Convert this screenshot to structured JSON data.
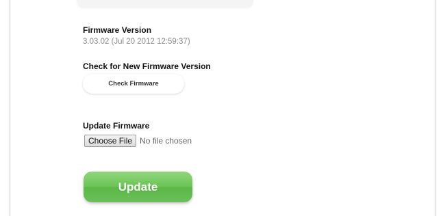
{
  "firmware": {
    "version_title": "Firmware Version",
    "version_value": "3.03.02 (Jul 20 2012 12:59:37)",
    "check_title": "Check for New Firmware Version",
    "check_button": "Check Firmware",
    "update_title": "Update Firmware",
    "choose_file_button": "Choose File",
    "no_file_text": "No file chosen",
    "update_button": "Update"
  },
  "colors": {
    "update_button_green": "#6cc457",
    "frame_border": "#c9c9c9"
  }
}
